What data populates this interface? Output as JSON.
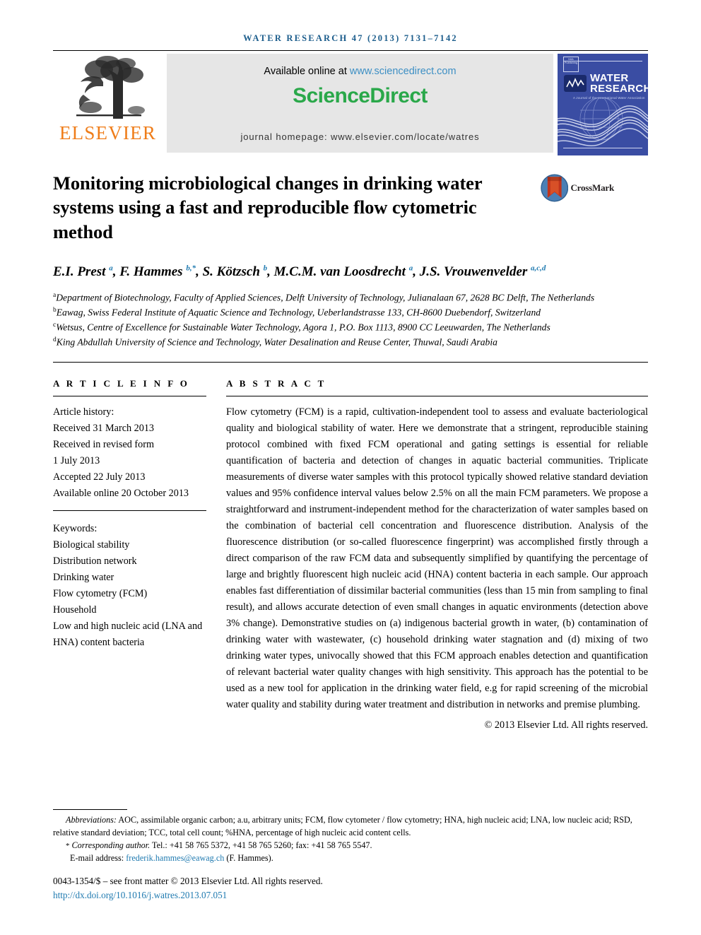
{
  "running_head": "WATER RESEARCH 47 (2013) 7131–7142",
  "masthead": {
    "publisher_name": "ELSEVIER",
    "available_prefix": "Available online at ",
    "available_link": "www.sciencedirect.com",
    "sciencedirect_logo": "ScienceDirect",
    "journal_homepage": "journal homepage: www.elsevier.com/locate/watres",
    "cover": {
      "title_line1": "WATER",
      "title_line2": "RESEARCH",
      "subtitle": "A Journal of the International Water Association",
      "badge_text": "IWA Publishing",
      "association_logo": "IWA"
    }
  },
  "article": {
    "title": "Monitoring microbiological changes in drinking water systems using a fast and reproducible flow cytometric method",
    "crossmark_label": "CrossMark",
    "authors_html": "E.I. Prest <sup>a</sup>, F. Hammes <sup>b,*</sup>, S. Kötzsch <sup>b</sup>, M.C.M. van Loosdrecht <sup>a</sup>, J.S. Vrouwenvelder <sup>a,c,d</sup>",
    "affiliations": [
      {
        "marker": "a",
        "text": "Department of Biotechnology, Faculty of Applied Sciences, Delft University of Technology, Julianalaan 67, 2628 BC Delft, The Netherlands"
      },
      {
        "marker": "b",
        "text": "Eawag, Swiss Federal Institute of Aquatic Science and Technology, Ueberlandstrasse 133, CH-8600 Duebendorf, Switzerland"
      },
      {
        "marker": "c",
        "text": "Wetsus, Centre of Excellence for Sustainable Water Technology, Agora 1, P.O. Box 1113, 8900 CC Leeuwarden, The Netherlands"
      },
      {
        "marker": "d",
        "text": "King Abdullah University of Science and Technology, Water Desalination and Reuse Center, Thuwal, Saudi Arabia"
      }
    ]
  },
  "article_info": {
    "heading": "A R T I C L E   I N F O",
    "history_label": "Article history:",
    "history": [
      "Received 31 March 2013",
      "Received in revised form",
      "1 July 2013",
      "Accepted 22 July 2013",
      "Available online 20 October 2013"
    ],
    "keywords_label": "Keywords:",
    "keywords": [
      "Biological stability",
      "Distribution network",
      "Drinking water",
      "Flow cytometry (FCM)",
      "Household",
      "Low and high nucleic acid (LNA and HNA) content bacteria"
    ]
  },
  "abstract": {
    "heading": "A B S T R A C T",
    "text": "Flow cytometry (FCM) is a rapid, cultivation-independent tool to assess and evaluate bacteriological quality and biological stability of water. Here we demonstrate that a stringent, reproducible staining protocol combined with fixed FCM operational and gating settings is essential for reliable quantification of bacteria and detection of changes in aquatic bacterial communities. Triplicate measurements of diverse water samples with this protocol typically showed relative standard deviation values and 95% confidence interval values below 2.5% on all the main FCM parameters. We propose a straightforward and instrument-independent method for the characterization of water samples based on the combination of bacterial cell concentration and fluorescence distribution. Analysis of the fluorescence distribution (or so-called fluorescence fingerprint) was accomplished firstly through a direct comparison of the raw FCM data and subsequently simplified by quantifying the percentage of large and brightly fluorescent high nucleic acid (HNA) content bacteria in each sample. Our approach enables fast differentiation of dissimilar bacterial communities (less than 15 min from sampling to final result), and allows accurate detection of even small changes in aquatic environments (detection above 3% change). Demonstrative studies on (a) indigenous bacterial growth in water, (b) contamination of drinking water with wastewater, (c) household drinking water stagnation and (d) mixing of two drinking water types, univocally showed that this FCM approach enables detection and quantification of relevant bacterial water quality changes with high sensitivity. This approach has the potential to be used as a new tool for application in the drinking water field, e.g for rapid screening of the microbial water quality and stability during water treatment and distribution in networks and premise plumbing.",
    "copyright": "© 2013 Elsevier Ltd. All rights reserved."
  },
  "footnotes": {
    "abbreviations_label": "Abbreviations:",
    "abbreviations_text": " AOC, assimilable organic carbon; a.u, arbitrary units; FCM, flow cytometer / flow cytometry; HNA, high nucleic acid; LNA, low nucleic acid; RSD, relative standard deviation; TCC, total cell count; %HNA, percentage of high nucleic acid content cells.",
    "corresponding_star": "*",
    "corresponding_label": "Corresponding author.",
    "corresponding_text": " Tel.: +41 58 765 5372, +41 58 765 5260; fax: +41 58 765 5547.",
    "email_label": "E-mail address:",
    "email_address": "frederik.hammes@eawag.ch",
    "email_suffix": " (F. Hammes)."
  },
  "footer": {
    "issn_line": "0043-1354/$ – see front matter © 2013 Elsevier Ltd. All rights reserved.",
    "doi": "http://dx.doi.org/10.1016/j.watres.2013.07.051"
  },
  "colors": {
    "running_head": "#1c5d8c",
    "elsevier_orange": "#ef7d1a",
    "sciencedirect_green": "#2aa84a",
    "link_blue": "#1f7ab0",
    "cover_blue": "#3a4da3"
  }
}
